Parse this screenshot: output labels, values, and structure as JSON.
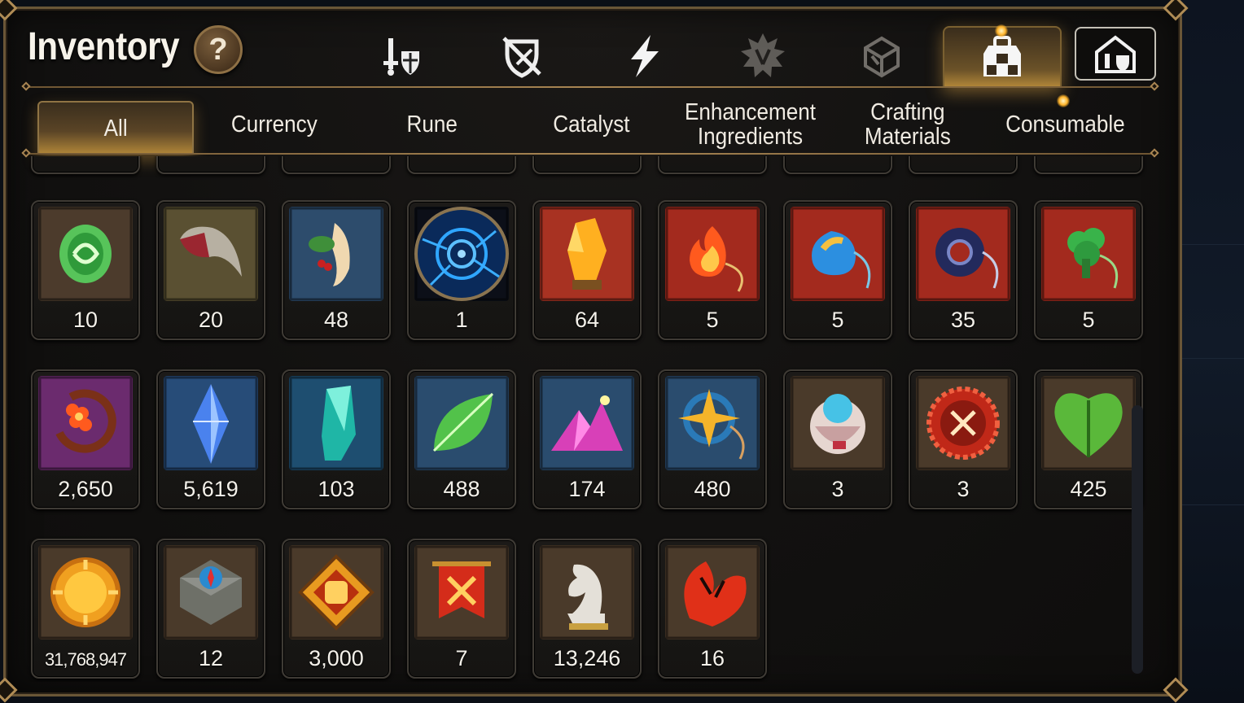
{
  "window": {
    "title": "Inventory",
    "help_label": "?"
  },
  "category_icons": [
    {
      "name": "equipment-icon",
      "active": false
    },
    {
      "name": "unequipped-icon",
      "active": false
    },
    {
      "name": "lightning-icon",
      "active": false
    },
    {
      "name": "artifact-icon",
      "active": false
    },
    {
      "name": "cube-icon",
      "active": false
    },
    {
      "name": "bag-icon",
      "active": true
    },
    {
      "name": "hero-storage-icon",
      "active": false
    }
  ],
  "tabs": [
    {
      "label": "All",
      "active": true
    },
    {
      "label": "Currency",
      "active": false
    },
    {
      "label": "Rune",
      "active": false
    },
    {
      "label": "Catalyst",
      "active": false
    },
    {
      "label": "Enhancement\nIngredients",
      "active": false
    },
    {
      "label": "Crafting\nMaterials",
      "active": false
    },
    {
      "label": "Consumable",
      "active": false
    }
  ],
  "rows": [
    {
      "partial": true,
      "items": [
        {
          "icon": "item-icon",
          "count": ""
        },
        {
          "icon": "item-icon",
          "count": ""
        },
        {
          "icon": "item-icon",
          "count": ""
        },
        {
          "icon": "item-icon",
          "count": ""
        },
        {
          "icon": "item-icon",
          "count": ""
        },
        {
          "icon": "item-icon",
          "count": ""
        },
        {
          "icon": "item-icon",
          "count": ""
        },
        {
          "icon": "item-icon",
          "count": ""
        },
        {
          "icon": "item-icon",
          "count": ""
        }
      ]
    },
    {
      "partial": false,
      "items": [
        {
          "icon": "green-gem-icon",
          "count": "10"
        },
        {
          "icon": "claw-icon",
          "count": "20"
        },
        {
          "icon": "herb-root-icon",
          "count": "48"
        },
        {
          "icon": "portal-orb-icon",
          "count": "1"
        },
        {
          "icon": "amber-crystal-icon",
          "count": "64"
        },
        {
          "icon": "fire-charm-icon",
          "count": "5"
        },
        {
          "icon": "water-charm-icon",
          "count": "5"
        },
        {
          "icon": "dark-disc-charm-icon",
          "count": "35"
        },
        {
          "icon": "tree-charm-icon",
          "count": "5"
        }
      ]
    },
    {
      "partial": false,
      "items": [
        {
          "icon": "flower-ring-icon",
          "count": "2,650"
        },
        {
          "icon": "blue-crystal-icon",
          "count": "5,619"
        },
        {
          "icon": "teal-crystal-icon",
          "count": "103"
        },
        {
          "icon": "green-leaf-icon",
          "count": "488"
        },
        {
          "icon": "pink-crystal-pile-icon",
          "count": "174"
        },
        {
          "icon": "star-charm-icon",
          "count": "480"
        },
        {
          "icon": "pod-device-icon",
          "count": "3"
        },
        {
          "icon": "red-seal-icon",
          "count": "3"
        },
        {
          "icon": "green-heart-leaf-icon",
          "count": "425"
        }
      ]
    },
    {
      "partial": false,
      "items": [
        {
          "icon": "gold-coin-icon",
          "count": "31,768,947"
        },
        {
          "icon": "stone-compass-icon",
          "count": "12"
        },
        {
          "icon": "fist-badge-icon",
          "count": "3,000"
        },
        {
          "icon": "war-banner-icon",
          "count": "7"
        },
        {
          "icon": "knight-chess-icon",
          "count": "13,246"
        },
        {
          "icon": "red-leaf-icon",
          "count": "16"
        }
      ]
    }
  ],
  "colors": {
    "panel_border": "#6a5637",
    "active_tab_glow": "#b68a3a",
    "text": "#f2ede4"
  }
}
